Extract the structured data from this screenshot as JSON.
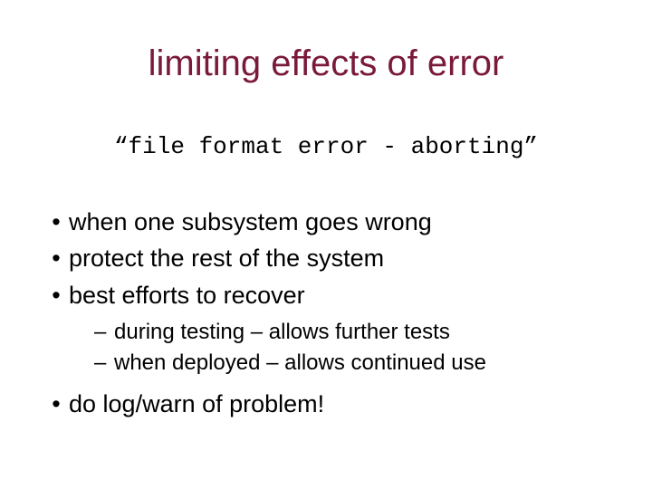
{
  "title": "limiting effects of error",
  "subtitle": "“file format error - aborting”",
  "bullets": {
    "b1": "when one subsystem goes wrong",
    "b2": "protect the rest of the system",
    "b3": "best efforts to recover",
    "b3_sub1": "during testing  –  allows further tests",
    "b3_sub2": "when deployed  –  allows continued use",
    "b4": "do log/warn of problem!"
  }
}
